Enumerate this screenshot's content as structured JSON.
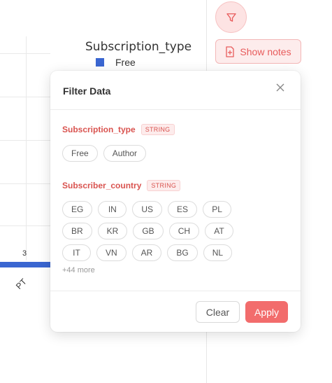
{
  "chart": {
    "legend_title": "Subscription_type",
    "legend_item": "Free",
    "bar_value_label": "3",
    "x_tick_label": "PT",
    "bar_color": "#3a66d1"
  },
  "toolbar": {
    "filter_icon": "filter-icon",
    "show_notes_label": "Show notes",
    "show_notes_icon": "add-note-icon"
  },
  "modal": {
    "title": "Filter Data",
    "sections": [
      {
        "name": "Subscription_type",
        "type": "STRING",
        "values": [
          "Free",
          "Author"
        ]
      },
      {
        "name": "Subscriber_country",
        "type": "STRING",
        "values": [
          "EG",
          "IN",
          "US",
          "ES",
          "PL",
          "BR",
          "KR",
          "GB",
          "CH",
          "AT",
          "IT",
          "VN",
          "AR",
          "BG",
          "NL"
        ],
        "more_label": "+44 more"
      }
    ],
    "clear_label": "Clear",
    "apply_label": "Apply",
    "accent_color": "#f26c6c"
  }
}
